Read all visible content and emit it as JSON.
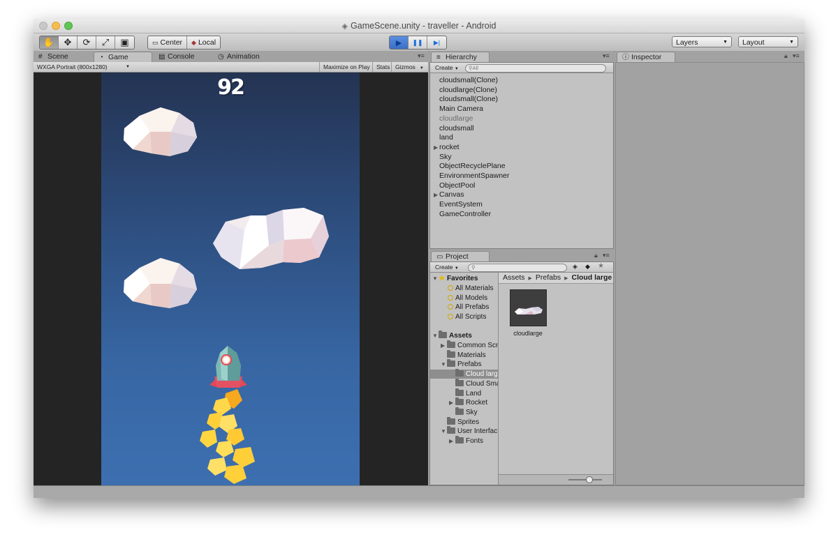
{
  "window": {
    "title": "GameScene.unity - traveller - Android"
  },
  "toolbar": {
    "tools": [
      {
        "name": "hand-tool",
        "glyph": "✋"
      },
      {
        "name": "move-tool",
        "glyph": "✥"
      },
      {
        "name": "rotate-tool",
        "glyph": "⟳"
      },
      {
        "name": "scale-tool",
        "glyph": "⤢"
      },
      {
        "name": "rect-tool",
        "glyph": "▣"
      }
    ],
    "pivot_label": "Center",
    "space_label": "Local",
    "play_glyph": "▶",
    "pause_glyph": "❚❚",
    "step_glyph": "▶|",
    "layers_label": "Layers",
    "layout_label": "Layout"
  },
  "tabs": {
    "scene": "Scene",
    "game": "Game",
    "console": "Console",
    "animation": "Animation",
    "hierarchy": "Hierarchy",
    "project": "Project",
    "inspector": "Inspector"
  },
  "game": {
    "resolution": "WXGA Portrait (800x1280)",
    "maximize": "Maximize on Play",
    "stats": "Stats",
    "gizmos": "Gizmos",
    "score": "92"
  },
  "hierarchy": {
    "create": "Create",
    "search_placeholder": "All",
    "items": [
      {
        "label": "cloudsmall(Clone)",
        "expandable": false,
        "dim": false
      },
      {
        "label": "cloudlarge(Clone)",
        "expandable": false,
        "dim": false
      },
      {
        "label": "cloudsmall(Clone)",
        "expandable": false,
        "dim": false
      },
      {
        "label": "Main Camera",
        "expandable": false,
        "dim": false
      },
      {
        "label": "cloudlarge",
        "expandable": false,
        "dim": true
      },
      {
        "label": "cloudsmall",
        "expandable": false,
        "dim": false
      },
      {
        "label": "land",
        "expandable": false,
        "dim": false
      },
      {
        "label": "rocket",
        "expandable": true,
        "dim": false
      },
      {
        "label": "Sky",
        "expandable": false,
        "dim": false
      },
      {
        "label": "ObjectRecyclePlane",
        "expandable": false,
        "dim": false
      },
      {
        "label": "EnvironmentSpawner",
        "expandable": false,
        "dim": false
      },
      {
        "label": "ObjectPool",
        "expandable": false,
        "dim": false
      },
      {
        "label": "Canvas",
        "expandable": true,
        "dim": false
      },
      {
        "label": "EventSystem",
        "expandable": false,
        "dim": false
      },
      {
        "label": "GameController",
        "expandable": false,
        "dim": false
      }
    ]
  },
  "project": {
    "create": "Create",
    "favorites_label": "Favorites",
    "favorites": [
      "All Materials",
      "All Models",
      "All Prefabs",
      "All Scripts"
    ],
    "assets_label": "Assets",
    "tree": [
      {
        "label": "Common Scr",
        "depth": 1,
        "expandable": true,
        "selected": false
      },
      {
        "label": "Materials",
        "depth": 1,
        "expandable": false,
        "selected": false
      },
      {
        "label": "Prefabs",
        "depth": 1,
        "expandable": true,
        "open": true,
        "selected": false
      },
      {
        "label": "Cloud larg",
        "depth": 2,
        "expandable": false,
        "selected": true
      },
      {
        "label": "Cloud Sma",
        "depth": 2,
        "expandable": false,
        "selected": false
      },
      {
        "label": "Land",
        "depth": 2,
        "expandable": false,
        "selected": false
      },
      {
        "label": "Rocket",
        "depth": 2,
        "expandable": true,
        "selected": false
      },
      {
        "label": "Sky",
        "depth": 2,
        "expandable": false,
        "selected": false
      },
      {
        "label": "Sprites",
        "depth": 1,
        "expandable": false,
        "selected": false
      },
      {
        "label": "User Interfac",
        "depth": 1,
        "expandable": true,
        "open": true,
        "selected": false
      },
      {
        "label": "Fonts",
        "depth": 2,
        "expandable": true,
        "selected": false
      }
    ],
    "breadcrumb": [
      "Assets",
      "Prefabs",
      "Cloud large"
    ],
    "asset_name": "cloudlarge"
  },
  "colors": {
    "play_accent": "#2f6fd1",
    "sky_top": "#243352",
    "sky_bottom": "#3d6fb0",
    "cloud": "#f1e6e6",
    "rocket": "#6fa8a4",
    "flame": "#ffc83a"
  }
}
